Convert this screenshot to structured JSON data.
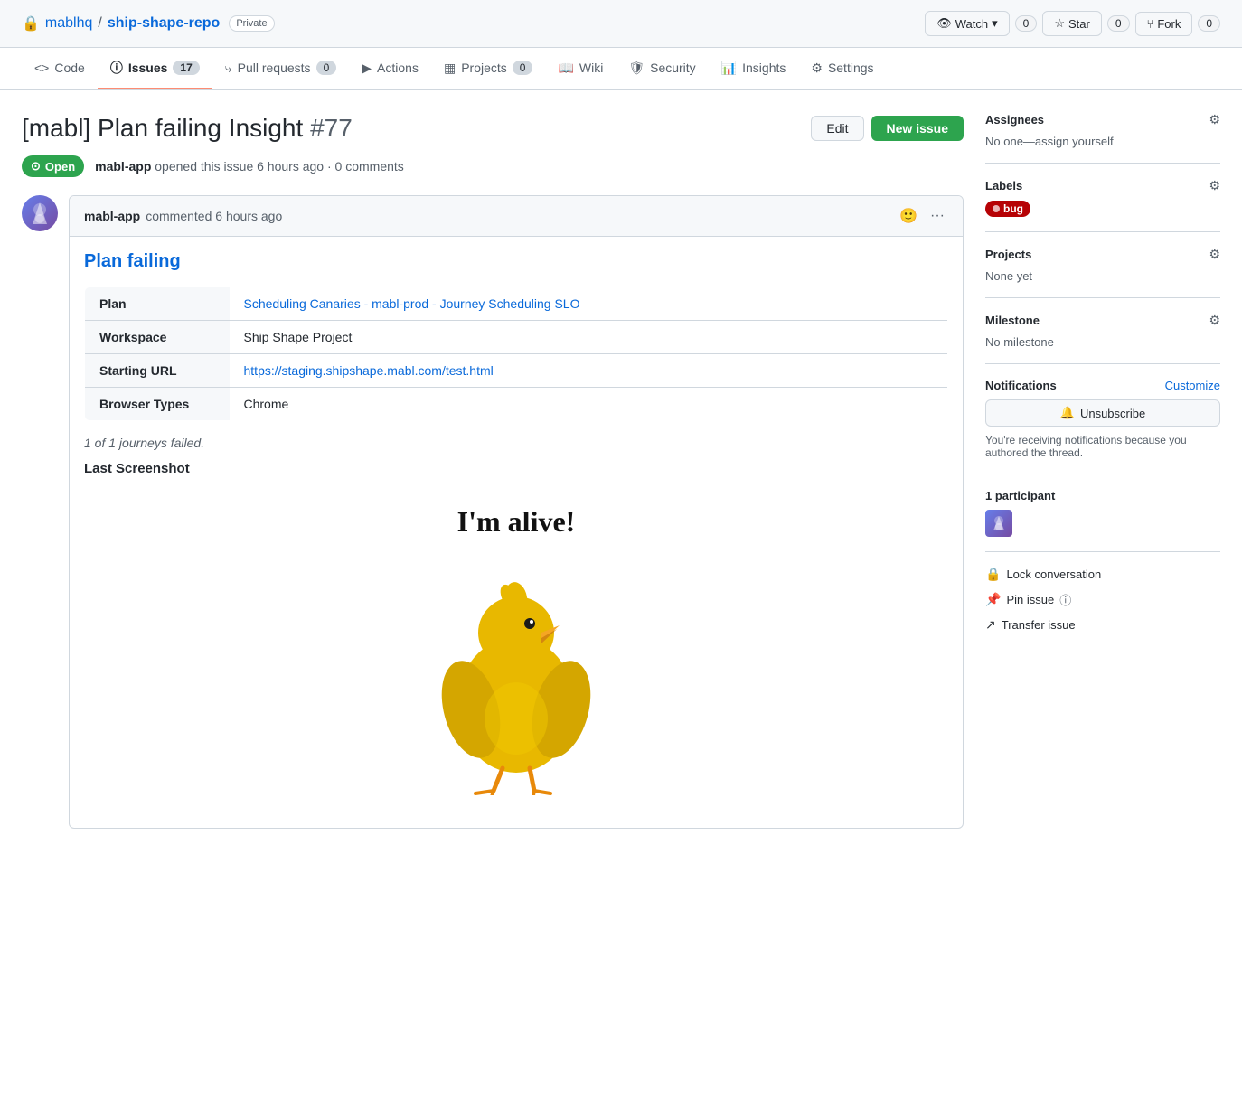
{
  "repo": {
    "owner": "mablhq",
    "name": "ship-shape-repo",
    "visibility": "Private",
    "lock_icon": "🔒"
  },
  "repo_actions": {
    "watch_label": "Watch",
    "watch_count": "0",
    "star_label": "Star",
    "star_count": "0",
    "fork_label": "Fork",
    "fork_count": "0"
  },
  "nav": {
    "tabs": [
      {
        "id": "code",
        "label": "Code",
        "count": null,
        "active": false
      },
      {
        "id": "issues",
        "label": "Issues",
        "count": "17",
        "active": true
      },
      {
        "id": "pull-requests",
        "label": "Pull requests",
        "count": "0",
        "active": false
      },
      {
        "id": "actions",
        "label": "Actions",
        "count": null,
        "active": false
      },
      {
        "id": "projects",
        "label": "Projects",
        "count": "0",
        "active": false
      },
      {
        "id": "wiki",
        "label": "Wiki",
        "count": null,
        "active": false
      },
      {
        "id": "security",
        "label": "Security",
        "count": null,
        "active": false
      },
      {
        "id": "insights",
        "label": "Insights",
        "count": null,
        "active": false
      },
      {
        "id": "settings",
        "label": "Settings",
        "count": null,
        "active": false
      }
    ]
  },
  "issue": {
    "title": "[mabl] Plan failing Insight",
    "number": "#77",
    "status": "Open",
    "author": "mabl-app",
    "time": "6 hours ago",
    "comments": "0 comments"
  },
  "buttons": {
    "edit": "Edit",
    "new_issue": "New issue"
  },
  "comment": {
    "author": "mabl-app",
    "time": "6 hours ago",
    "heading": "Plan failing",
    "table": {
      "rows": [
        {
          "label": "Plan",
          "value": "Scheduling Canaries - mabl-prod - Journey Scheduling SLO",
          "is_link": true,
          "href": "#"
        },
        {
          "label": "Workspace",
          "value": "Ship Shape Project",
          "is_link": false
        },
        {
          "label": "Starting URL",
          "value": "https://staging.shipshape.mabl.com/test.html",
          "is_link": true,
          "href": "https://staging.shipshape.mabl.com/test.html"
        },
        {
          "label": "Browser Types",
          "value": "Chrome",
          "is_link": false
        }
      ]
    },
    "journey_text": "1 of 1 journeys failed.",
    "last_screenshot_label": "Last Screenshot",
    "screenshot_text": "I'm alive!"
  },
  "sidebar": {
    "assignees": {
      "title": "Assignees",
      "value": "No one—assign yourself"
    },
    "labels": {
      "title": "Labels",
      "items": [
        {
          "name": "bug",
          "color": "#b60205"
        }
      ]
    },
    "projects": {
      "title": "Projects",
      "value": "None yet"
    },
    "milestone": {
      "title": "Milestone",
      "value": "No milestone"
    },
    "notifications": {
      "title": "Notifications",
      "customize": "Customize",
      "btn_label": "Unsubscribe",
      "description": "You're receiving notifications because you authored the thread."
    },
    "participants": {
      "count": "1 participant"
    },
    "actions": {
      "lock": "Lock conversation",
      "pin": "Pin issue",
      "transfer": "Transfer issue"
    }
  }
}
